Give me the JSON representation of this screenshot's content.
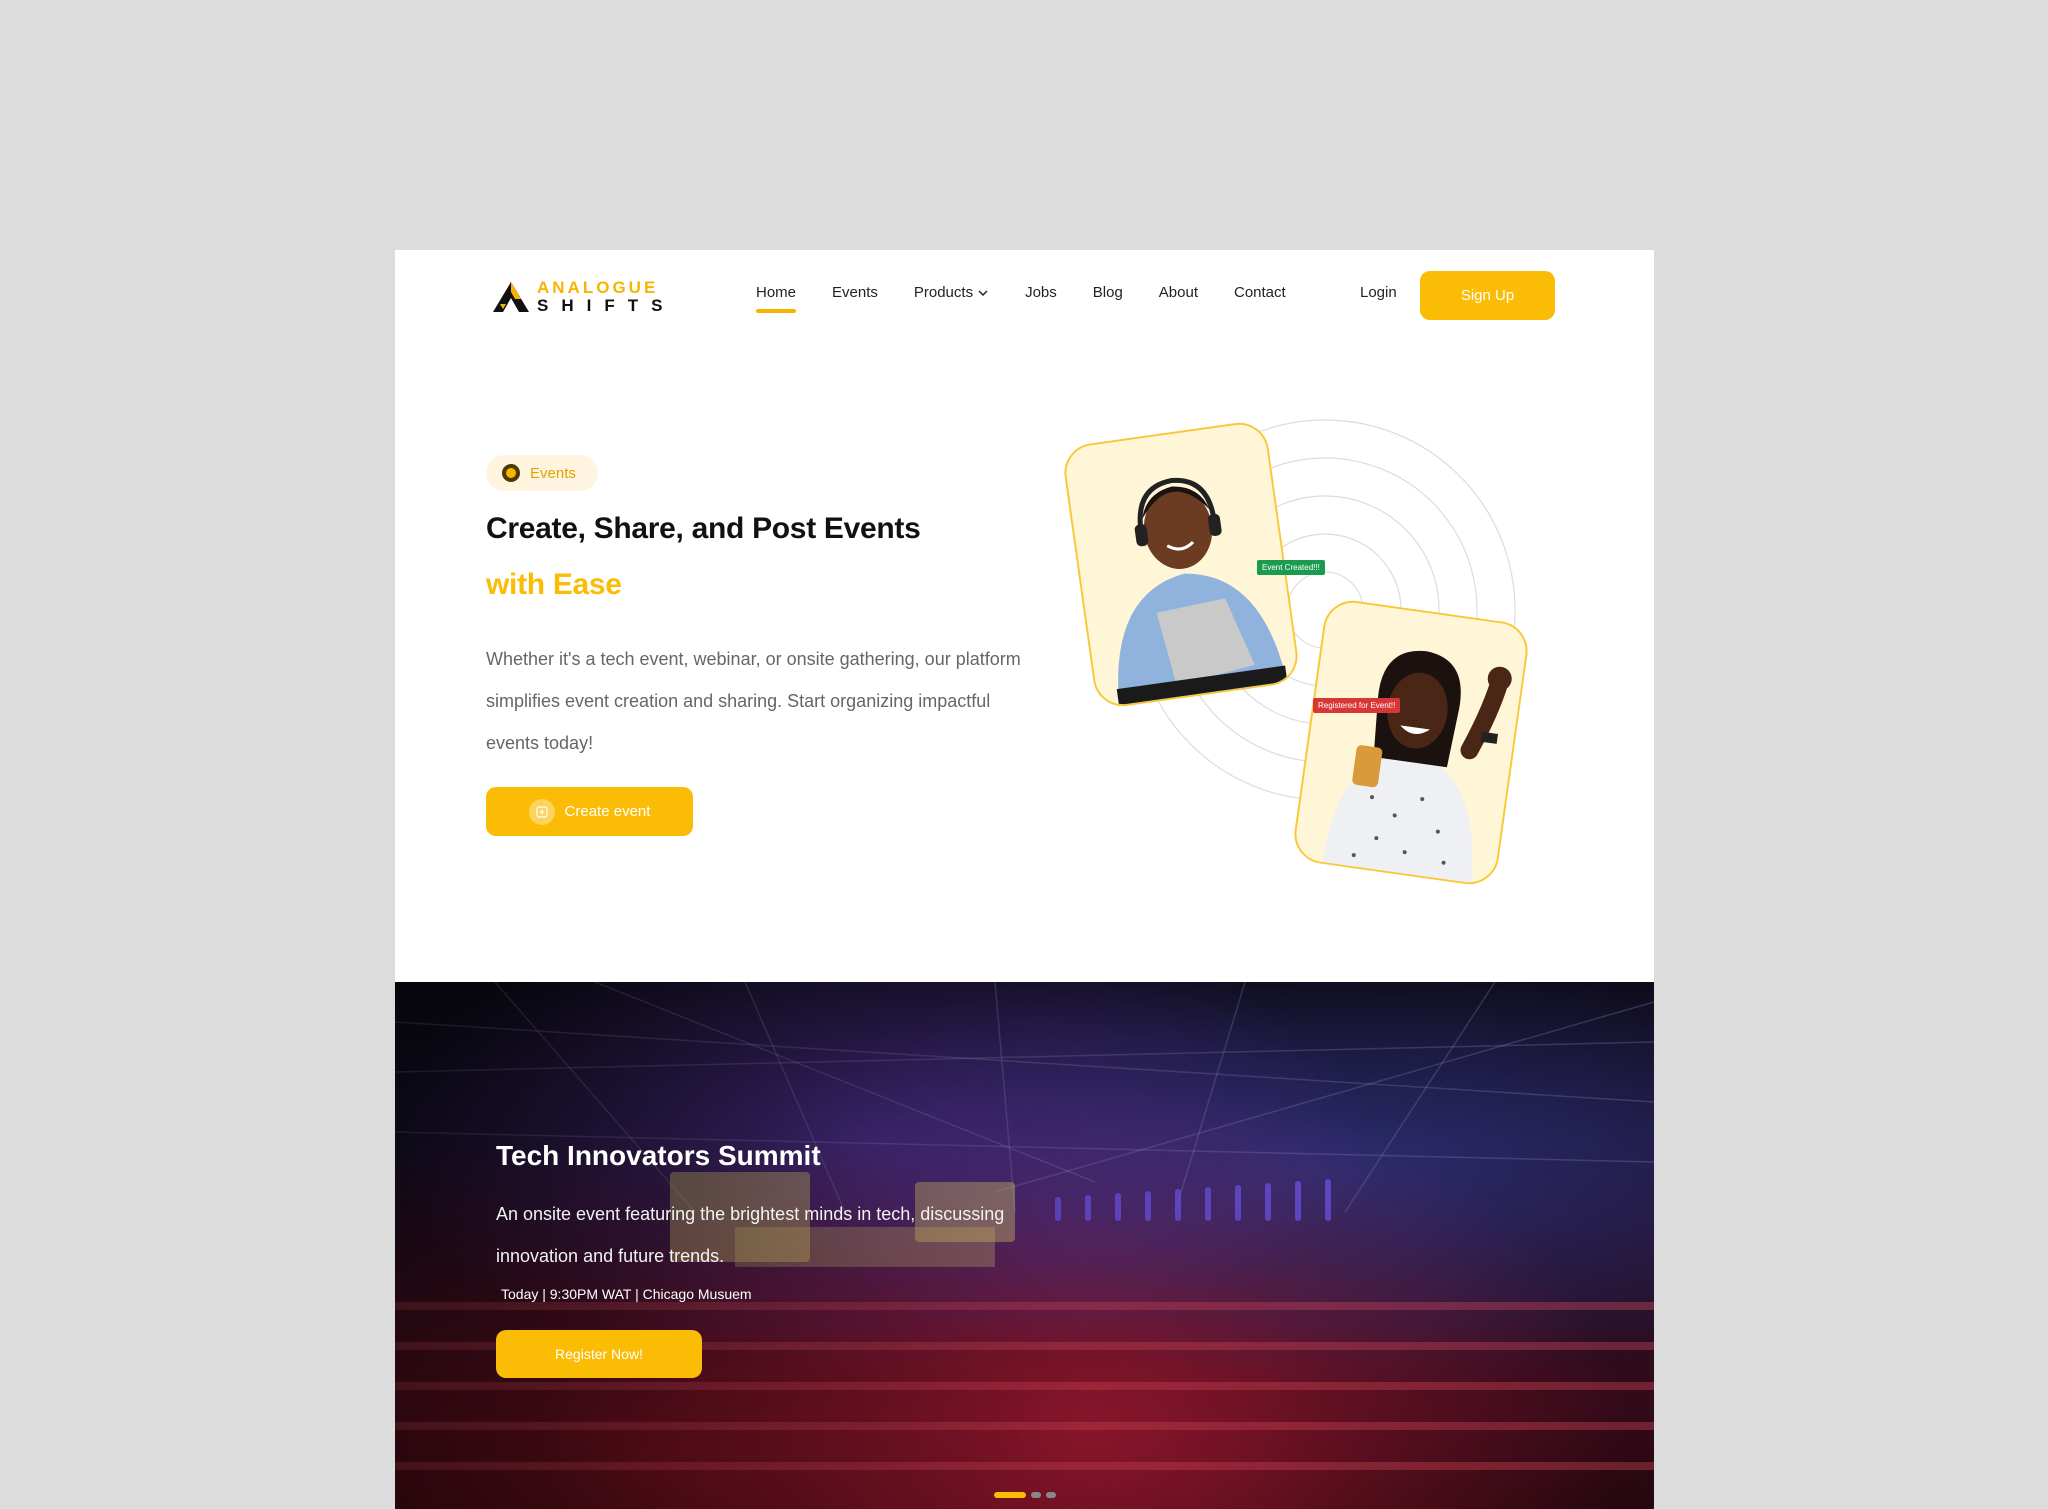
{
  "brand": {
    "name_top": "ANALOGUE",
    "name_bottom": "SHIFTS",
    "accent": "#fbbc05"
  },
  "nav": {
    "items": [
      {
        "label": "Home",
        "active": true
      },
      {
        "label": "Events"
      },
      {
        "label": "Products",
        "has_dropdown": true
      },
      {
        "label": "Jobs"
      },
      {
        "label": "Blog"
      },
      {
        "label": "About"
      },
      {
        "label": "Contact"
      }
    ],
    "login": "Login",
    "signup": "Sign Up"
  },
  "hero": {
    "badge": "Events",
    "title_line1": "Create, Share, and Post Events",
    "title_line2": "with Ease",
    "description": "Whether it's a tech event, webinar, or onsite gathering, our platform simplifies event creation and sharing. Start organizing impactful events today!",
    "cta": "Create event",
    "tag_created": "Event Created!!!",
    "tag_registered": "Registered for Event!!"
  },
  "event": {
    "title": "Tech Innovators Summit",
    "description": "An onsite event featuring the brightest minds in tech, discussing innovation and future trends.",
    "meta": "Today | 9:30PM WAT | Chicago Musuem",
    "cta": "Register Now!",
    "slides": 3,
    "active_slide": 1
  }
}
